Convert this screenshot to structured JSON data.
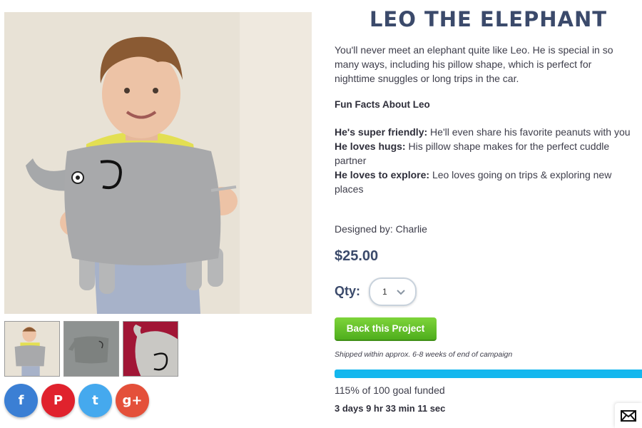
{
  "product": {
    "title": "LEO THE ELEPHANT",
    "description": "You'll never meet an elephant quite like Leo. He is special in so many ways, including his pillow shape, which is perfect for nighttime snuggles or long trips in the car.",
    "facts_heading": "Fun Facts About Leo",
    "facts": [
      {
        "label": "He's super friendly:",
        "text": "He'll even share his favorite peanuts with you"
      },
      {
        "label": "He loves hugs:",
        "text": "His pillow shape makes for the perfect cuddle partner"
      },
      {
        "label": "He loves to explore:",
        "text": "Leo loves going on trips & exploring new places"
      }
    ],
    "designed_by": "Designed by: Charlie",
    "price": "$25.00"
  },
  "purchase": {
    "qty_label": "Qty:",
    "qty_value": "1",
    "back_button": "Back this Project",
    "shipping_note": "Shipped within approx. 6-8 weeks of end of campaign"
  },
  "campaign": {
    "progress_fraction": 1.0,
    "funded_text": "115% of 100 goal funded",
    "countdown": "3 days 9 hr 33 min 11 sec"
  },
  "social": [
    {
      "name": "facebook",
      "glyph": "f",
      "color": "#3b7fd4"
    },
    {
      "name": "pinterest",
      "glyph": "P",
      "color": "#e0222d"
    },
    {
      "name": "twitter",
      "glyph": "t",
      "color": "#45a9ee"
    },
    {
      "name": "google-plus",
      "glyph": "g+",
      "color": "#e4503a"
    }
  ],
  "icons": {
    "qty_chevron": "chevron-down-icon",
    "mail": "mail-icon"
  },
  "colors": {
    "title": "#3b4a6b",
    "button_green": "#5cbf26",
    "progress": "#14b7ee"
  }
}
